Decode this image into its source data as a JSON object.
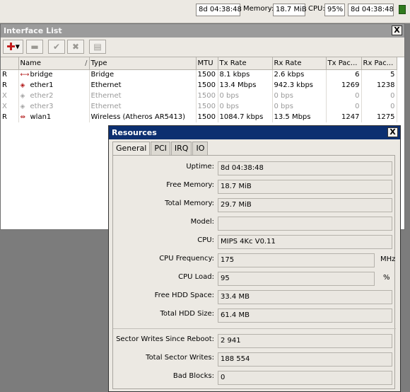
{
  "statusbar": {
    "uptime": "8d 04:38:48",
    "memory_label": "Memory:",
    "memory_value": "18.7 MiB",
    "cpu_label": "CPU:",
    "cpu_value": "95%",
    "uptime2": "8d 04:38:48",
    "indicator_color": "#2f7a1d"
  },
  "interface_list": {
    "title": "Interface List",
    "close_label": "X",
    "toolbar": {
      "add_icon": "plus-icon",
      "remove_icon": "minus-icon",
      "enable_icon": "check-icon",
      "disable_icon": "cross-icon",
      "comment_icon": "comment-icon"
    },
    "columns": [
      "",
      "Name",
      "Type",
      "MTU",
      "Tx Rate",
      "Rx Rate",
      "Tx Pac...",
      "Rx Pac..."
    ],
    "rows": [
      {
        "flag": "R",
        "icon": "bridge-icon",
        "name": "bridge",
        "type": "Bridge",
        "mtu": "1500",
        "tx_rate": "8.1 kbps",
        "rx_rate": "2.6 kbps",
        "tx_pac": "6",
        "rx_pac": "5",
        "disabled": false
      },
      {
        "flag": "R",
        "icon": "ethernet-icon",
        "name": "ether1",
        "type": "Ethernet",
        "mtu": "1500",
        "tx_rate": "13.4 Mbps",
        "rx_rate": "942.3 kbps",
        "tx_pac": "1269",
        "rx_pac": "1238",
        "disabled": false
      },
      {
        "flag": "X",
        "icon": "ethernet-icon",
        "name": "ether2",
        "type": "Ethernet",
        "mtu": "1500",
        "tx_rate": "0 bps",
        "rx_rate": "0 bps",
        "tx_pac": "0",
        "rx_pac": "0",
        "disabled": true
      },
      {
        "flag": "X",
        "icon": "ethernet-icon",
        "name": "ether3",
        "type": "Ethernet",
        "mtu": "1500",
        "tx_rate": "0 bps",
        "rx_rate": "0 bps",
        "tx_pac": "0",
        "rx_pac": "0",
        "disabled": true
      },
      {
        "flag": "R",
        "icon": "wireless-icon",
        "name": "wlan1",
        "type": "Wireless (Atheros AR5413)",
        "mtu": "1500",
        "tx_rate": "1084.7 kbps",
        "rx_rate": "13.5 Mbps",
        "tx_pac": "1247",
        "rx_pac": "1275",
        "disabled": false
      }
    ]
  },
  "resources": {
    "title": "Resources",
    "close_label": "X",
    "tabs": [
      "General",
      "PCI",
      "IRQ",
      "IO"
    ],
    "active_tab": "General",
    "fields": {
      "uptime": {
        "label": "Uptime:",
        "value": "8d 04:38:48"
      },
      "free_memory": {
        "label": "Free Memory:",
        "value": "18.7 MiB"
      },
      "total_memory": {
        "label": "Total Memory:",
        "value": "29.7 MiB"
      },
      "model": {
        "label": "Model:",
        "value": ""
      },
      "cpu": {
        "label": "CPU:",
        "value": "MIPS 4Kc V0.11"
      },
      "cpu_frequency": {
        "label": "CPU Frequency:",
        "value": "175",
        "unit": "MHz"
      },
      "cpu_load": {
        "label": "CPU Load:",
        "value": "95",
        "unit": "%"
      },
      "free_hdd": {
        "label": "Free HDD Space:",
        "value": "33.4 MB"
      },
      "total_hdd": {
        "label": "Total HDD Size:",
        "value": "61.4 MB"
      },
      "sector_writes_reboot": {
        "label": "Sector Writes Since Reboot:",
        "value": "2 941"
      },
      "total_sector_writes": {
        "label": "Total Sector Writes:",
        "value": "188 554"
      },
      "bad_blocks": {
        "label": "Bad Blocks:",
        "value": "0"
      }
    }
  }
}
